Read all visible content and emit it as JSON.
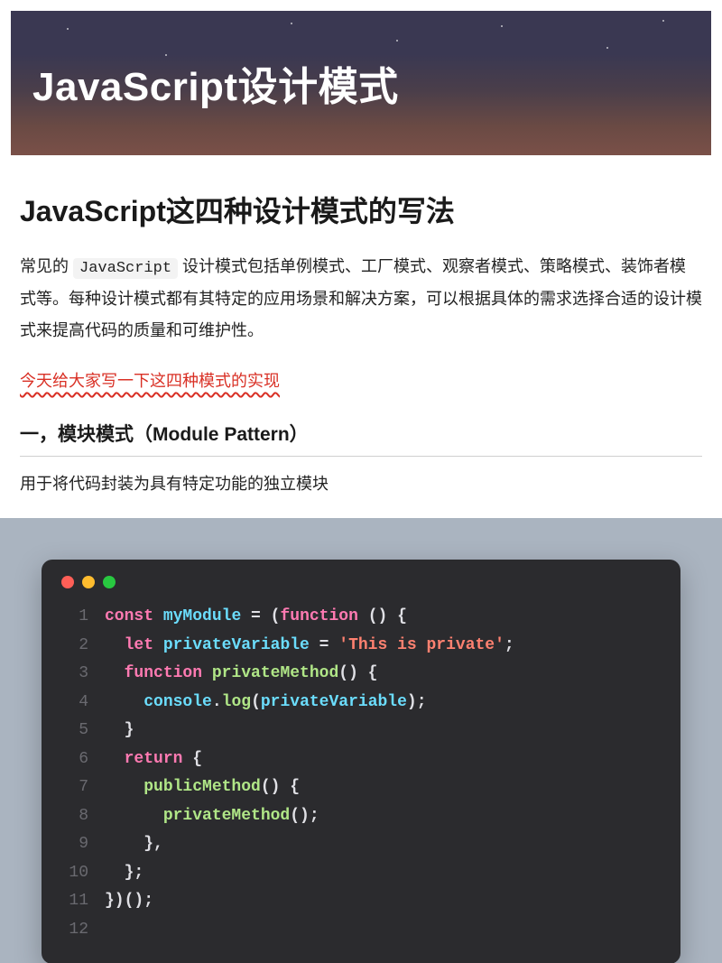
{
  "hero": {
    "title": "JavaScript设计模式"
  },
  "page": {
    "title": "JavaScript这四种设计模式的写法"
  },
  "intro": {
    "prefix": "常见的 ",
    "code": "JavaScript",
    "suffix": " 设计模式包括单例模式、工厂模式、观察者模式、策略模式、装饰者模式等。每种设计模式都有其特定的应用场景和解决方案，可以根据具体的需求选择合适的设计模式来提高代码的质量和可维护性。"
  },
  "highlight": "今天给大家写一下这四种模式的实现",
  "section1": {
    "heading": "一，模块模式（Module Pattern）",
    "desc": "用于将代码封装为具有特定功能的独立模块"
  },
  "code": {
    "lines": [
      {
        "n": "1",
        "tokens": [
          {
            "t": "kw",
            "v": "const"
          },
          {
            "t": "pun",
            "v": " "
          },
          {
            "t": "name",
            "v": "myModule"
          },
          {
            "t": "pun",
            "v": " = ("
          },
          {
            "t": "kw",
            "v": "function"
          },
          {
            "t": "pun",
            "v": " () {"
          }
        ]
      },
      {
        "n": "2",
        "tokens": [
          {
            "t": "pun",
            "v": "  "
          },
          {
            "t": "kw",
            "v": "let"
          },
          {
            "t": "pun",
            "v": " "
          },
          {
            "t": "name",
            "v": "privateVariable"
          },
          {
            "t": "pun",
            "v": " = "
          },
          {
            "t": "str",
            "v": "'This is private'"
          },
          {
            "t": "pun",
            "v": ";"
          }
        ]
      },
      {
        "n": "3",
        "tokens": [
          {
            "t": "pun",
            "v": "  "
          },
          {
            "t": "kw",
            "v": "function"
          },
          {
            "t": "pun",
            "v": " "
          },
          {
            "t": "fn",
            "v": "privateMethod"
          },
          {
            "t": "pun",
            "v": "() {"
          }
        ]
      },
      {
        "n": "4",
        "tokens": [
          {
            "t": "pun",
            "v": "    "
          },
          {
            "t": "obj",
            "v": "console"
          },
          {
            "t": "pun",
            "v": "."
          },
          {
            "t": "prop",
            "v": "log"
          },
          {
            "t": "pun",
            "v": "("
          },
          {
            "t": "name",
            "v": "privateVariable"
          },
          {
            "t": "pun",
            "v": ");"
          }
        ]
      },
      {
        "n": "5",
        "tokens": [
          {
            "t": "pun",
            "v": "  }"
          }
        ]
      },
      {
        "n": "6",
        "tokens": [
          {
            "t": "pun",
            "v": "  "
          },
          {
            "t": "kw",
            "v": "return"
          },
          {
            "t": "pun",
            "v": " {"
          }
        ]
      },
      {
        "n": "7",
        "tokens": [
          {
            "t": "pun",
            "v": "    "
          },
          {
            "t": "prop",
            "v": "publicMethod"
          },
          {
            "t": "pun",
            "v": "() {"
          }
        ]
      },
      {
        "n": "8",
        "tokens": [
          {
            "t": "pun",
            "v": "      "
          },
          {
            "t": "fn",
            "v": "privateMethod"
          },
          {
            "t": "pun",
            "v": "();"
          }
        ]
      },
      {
        "n": "9",
        "tokens": [
          {
            "t": "pun",
            "v": "    },"
          }
        ]
      },
      {
        "n": "10",
        "tokens": [
          {
            "t": "pun",
            "v": "  };"
          }
        ]
      },
      {
        "n": "11",
        "tokens": [
          {
            "t": "pun",
            "v": "})();"
          }
        ]
      },
      {
        "n": "12",
        "tokens": []
      }
    ]
  }
}
